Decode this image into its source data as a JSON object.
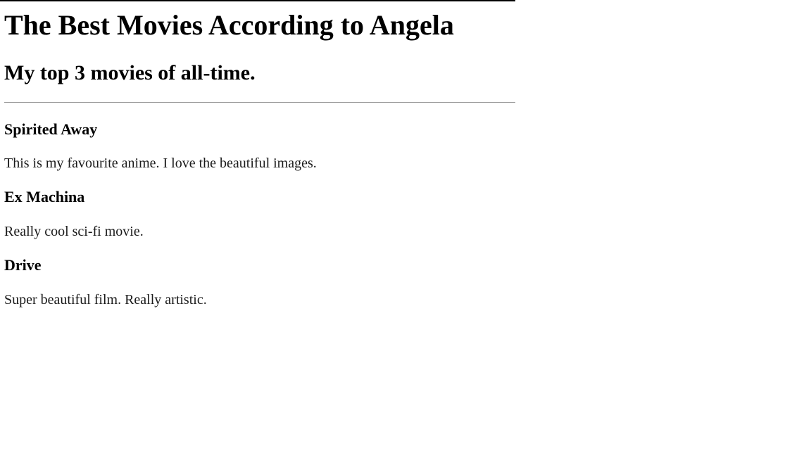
{
  "page": {
    "title": "The Best Movies According to Angela",
    "subtitle": "My top 3 movies of all-time."
  },
  "movies": [
    {
      "title": "Spirited Away",
      "description": "This is my favourite anime. I love the beautiful images."
    },
    {
      "title": "Ex Machina",
      "description": "Really cool sci-fi movie."
    },
    {
      "title": "Drive",
      "description": "Super beautiful film. Really artistic."
    }
  ]
}
